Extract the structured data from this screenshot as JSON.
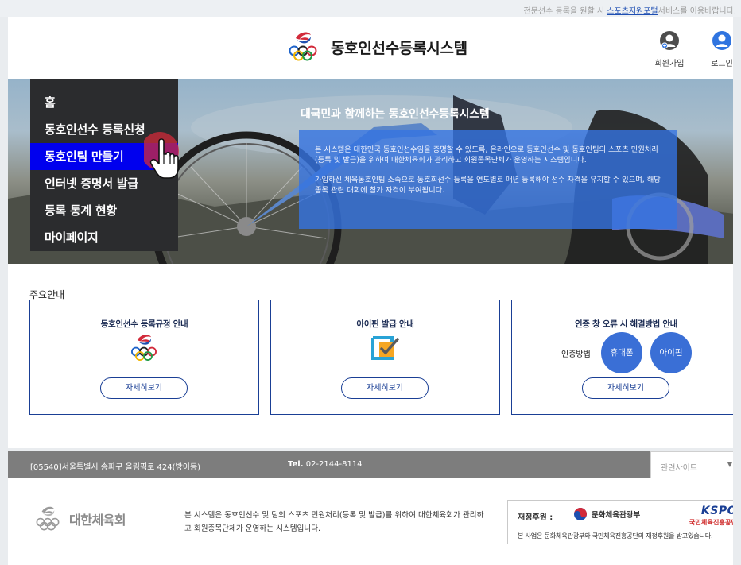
{
  "top_notice": {
    "prefix": "전문선수 등록을 원할 시 ",
    "link": "스포츠지원포털",
    "suffix": "서비스를 이용바랍니다."
  },
  "header": {
    "title": "동호인선수등록시스템",
    "join_label": "회원가입",
    "login_label": "로그인"
  },
  "menu": {
    "items": [
      {
        "label": "홈"
      },
      {
        "label": "동호인선수 등록신청"
      },
      {
        "label": "동호인팀 만들기"
      },
      {
        "label": "인터넷 증명서 발급"
      },
      {
        "label": "등록 통계 현황"
      },
      {
        "label": "마이페이지"
      }
    ],
    "active_index": 2
  },
  "hero": {
    "title": "대국민과 함께하는 동호인선수등록시스템",
    "para1": "본 시스템은 대한민국 동호인선수임을 증명할 수 있도록, 온라인으로 동호인선수 및 동호인팀의 스포츠 민원처리(등록 및 발급)을 위하여 대한체육회가 관리하고 회원종목단체가 운영하는 시스템입니다.",
    "para2": "가입하신 체육동호인팀 소속으로 동호회선수 등록을 연도별로 매년 등록해야 선수 자격을 유지할 수 있으며, 해당 종목 관련 대회에 참가 자격이 부여됩니다."
  },
  "main": {
    "section_title": "주요안내",
    "cards": [
      {
        "title": "동호인선수 등록규정 안내",
        "button": "자세히보기"
      },
      {
        "title": "아이핀 발급 안내",
        "button": "자세히보기"
      },
      {
        "title": "인증 창 오류 시 해결방법 안내",
        "button": "자세히보기",
        "method_label": "인증방법",
        "methods": [
          "휴대폰",
          "아이핀"
        ]
      }
    ]
  },
  "address_bar": {
    "address": "[05540]서울특별시 송파구 올림픽로 424(방이동)",
    "tel_label": "Tel.",
    "tel": "02-2144-8114",
    "related_sites": "관련사이트"
  },
  "footer": {
    "org_name": "대한체육회",
    "description": "본 시스템은 동호인선수 및 팀의 스포츠 민원처리(등록 및 발급)를 위하여 대한체육회가 관리하고 회원종목단체가 운영하는 시스템입니다.",
    "sponsor_label": "재정후원 :",
    "ministry": "문화체육관광부",
    "kspo_logo": "KSPO",
    "kspo_name": "국민체육진흥공단",
    "sponsor_note": "본 사업은 문화체육관광부와 국민체육진흥공단의 재정후원을 받고있습니다."
  },
  "colors": {
    "accent_blue": "#1a3f95",
    "menu_active": "#0000ee",
    "menu_bg": "#2b2c2e",
    "hero_box": "#3573e1",
    "footer_bar": "#7d7d7d"
  },
  "icons": [
    "olympic-rings-logo",
    "join-user-icon",
    "login-user-icon",
    "hand-pointer-icon",
    "ipin-icon",
    "chevron-down-icon"
  ]
}
